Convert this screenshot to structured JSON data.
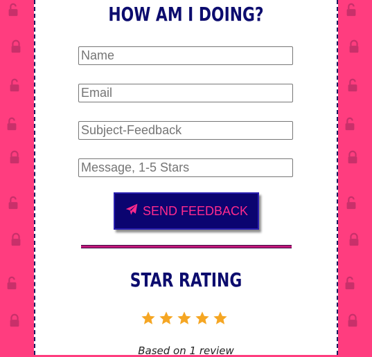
{
  "colors": {
    "background": "#ff3d7f",
    "accent_pink": "#ff2a8d",
    "navy": "#0c0c6e",
    "star": "#f5a623",
    "lock_icon": "#c8306a"
  },
  "contact": {
    "title": "HOW AM I DOING?",
    "fields": [
      {
        "placeholder": "Name"
      },
      {
        "placeholder": "Email"
      },
      {
        "placeholder": "Subject-Feedback"
      },
      {
        "placeholder": "Message, 1-5 Stars"
      }
    ],
    "submit_label": "SEND FEEDBACK",
    "submit_icon": "paper-plane-icon"
  },
  "rating": {
    "title": "STAR RATING",
    "stars": 5,
    "max_stars": 5,
    "summary": "Based on 1 review"
  },
  "background_pattern_icon": "unlock-icon"
}
